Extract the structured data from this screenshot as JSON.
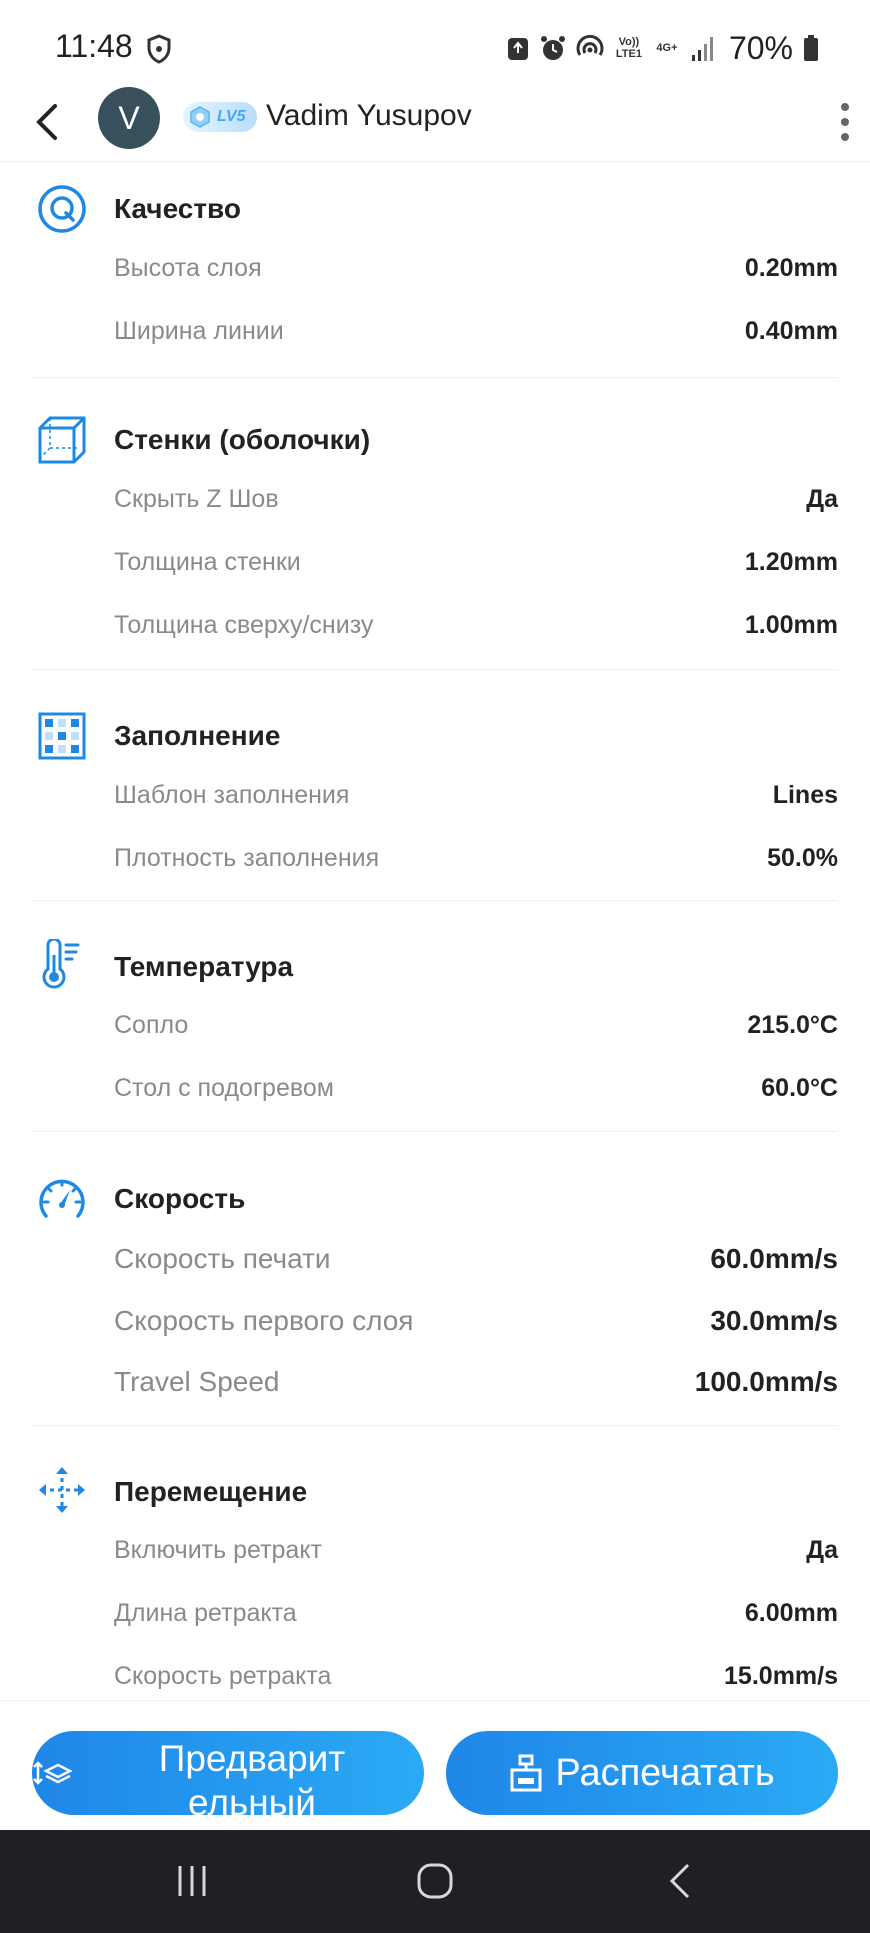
{
  "status_bar": {
    "time": "11:48",
    "volte": "Vo)) LTE1",
    "network": "4G+",
    "battery": "70%"
  },
  "header": {
    "avatar_letter": "V",
    "level_badge": "LV5",
    "user_name": "Vadim Yusupov"
  },
  "sections": {
    "quality": {
      "title": "Качество",
      "icon": "quality-q-icon",
      "rows": [
        {
          "label": "Высота слоя",
          "value": "0.20mm"
        },
        {
          "label": "Ширина линии",
          "value": "0.40mm"
        }
      ]
    },
    "walls": {
      "title": "Стенки (оболочки)",
      "icon": "cube-icon",
      "rows": [
        {
          "label": "Скрыть Z Шов",
          "value": "Да"
        },
        {
          "label": "Толщина стенки",
          "value": "1.20mm"
        },
        {
          "label": "Толщина сверху/снизу",
          "value": "1.00mm"
        }
      ]
    },
    "infill": {
      "title": "Заполнение",
      "icon": "infill-grid-icon",
      "rows": [
        {
          "label": "Шаблон заполнения",
          "value": "Lines"
        },
        {
          "label": "Плотность заполнения",
          "value": "50.0%"
        }
      ]
    },
    "temperature": {
      "title": "Температура",
      "icon": "thermometer-icon",
      "rows": [
        {
          "label": "Сопло",
          "value": "215.0°C"
        },
        {
          "label": "Стол с подогревом",
          "value": "60.0°C"
        }
      ]
    },
    "speed": {
      "title": "Скорость",
      "icon": "speedometer-icon",
      "rows": [
        {
          "label": "Скорость печати",
          "value": "60.0mm/s"
        },
        {
          "label": "Скорость первого слоя",
          "value": "30.0mm/s"
        },
        {
          "label": "Travel Speed",
          "value": "100.0mm/s"
        }
      ]
    },
    "travel": {
      "title": "Перемещение",
      "icon": "move-arrows-icon",
      "rows": [
        {
          "label": "Включить ретракт",
          "value": "Да"
        },
        {
          "label": "Длина ретракта",
          "value": "6.00mm"
        },
        {
          "label": "Скорость ретракта",
          "value": "15.0mm/s"
        }
      ]
    }
  },
  "actions": {
    "preview_label": "Предварительный",
    "print_label": "Распечатать"
  },
  "colors": {
    "accent": "#1f86e8",
    "accent_light": "#2aaaf5",
    "label_gray": "#8a8a8a",
    "navbar": "#1f1f24"
  }
}
